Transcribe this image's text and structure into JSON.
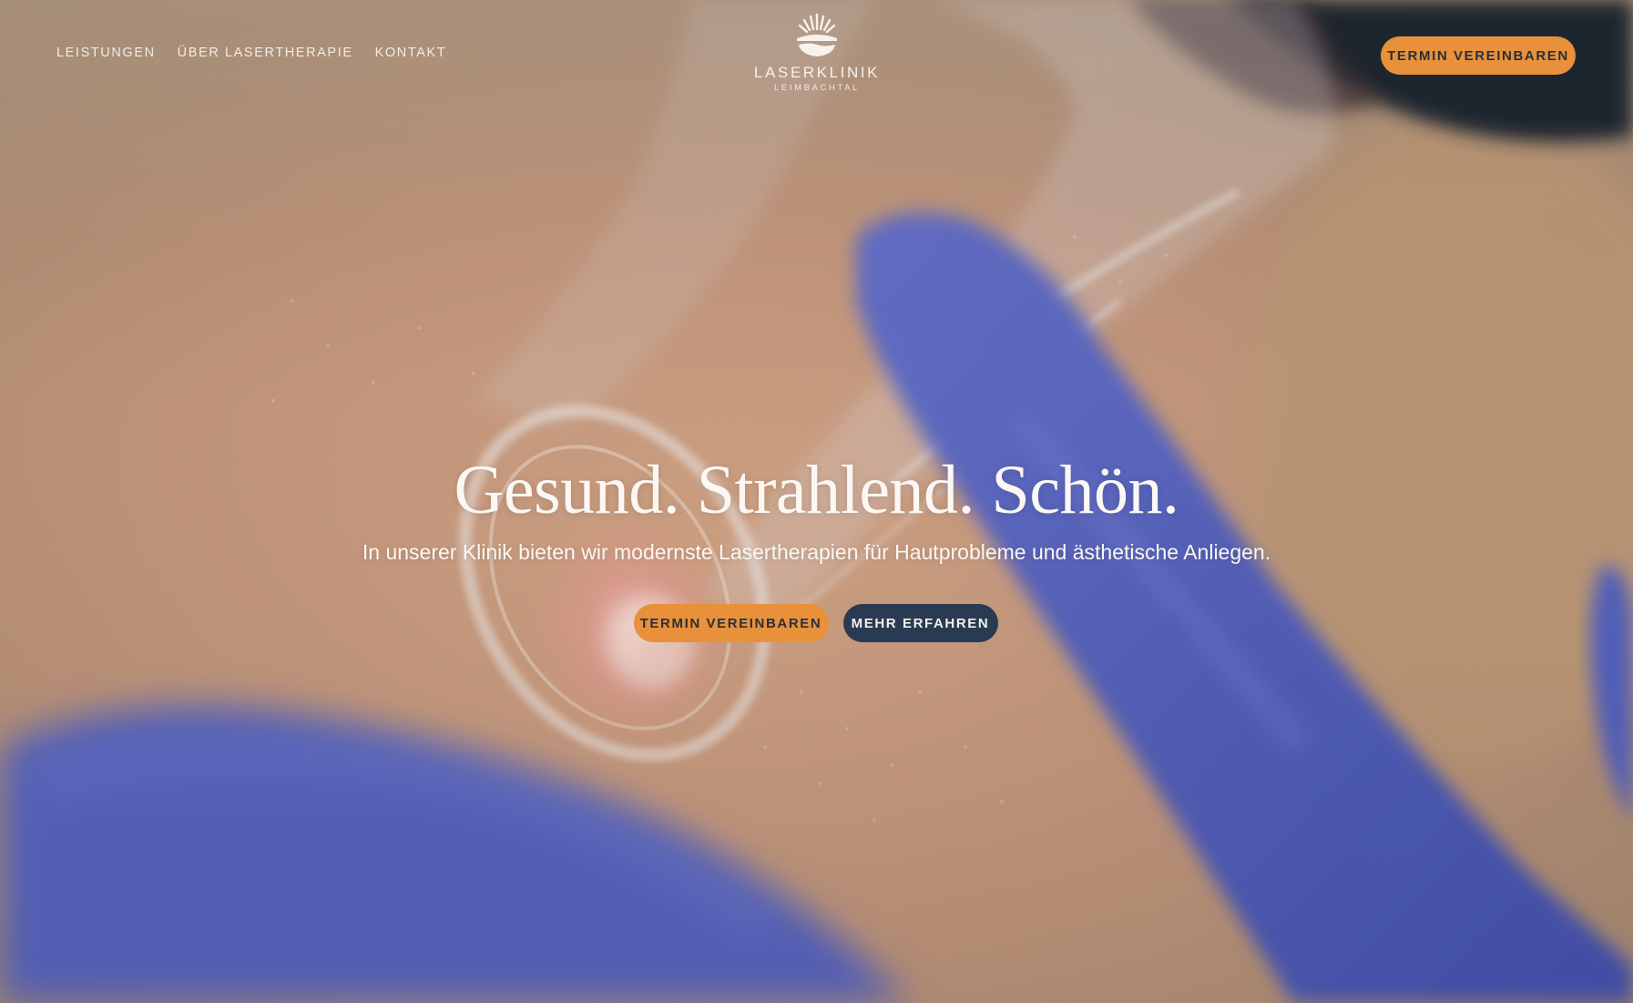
{
  "nav": {
    "links": [
      "LEISTUNGEN",
      "ÜBER LASERTHERAPIE",
      "KONTAKT"
    ],
    "cta_label": "TERMIN VEREINBAREN"
  },
  "logo": {
    "name": "LASERKLINIK",
    "subtitle": "LEIMBACHTAL"
  },
  "hero": {
    "title": "Gesund. Strahlend. Schön.",
    "subtitle": "In unserer Klinik bieten wir modernste Lasertherapien für Hautprobleme und ästhetische Anliegen.",
    "primary_cta": "TERMIN VEREINBAREN",
    "secondary_cta": "MEHR ERFAHREN"
  },
  "colors": {
    "accent_orange": "#e8913a",
    "navy": "#2a3a52",
    "glove_blue": "#5765c2",
    "skin": "#c9a487"
  }
}
